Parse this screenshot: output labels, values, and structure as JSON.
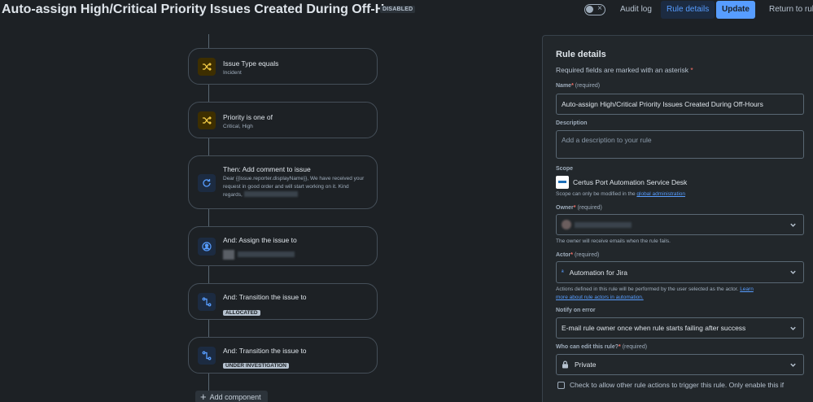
{
  "header": {
    "title": "Auto-assign High/Critical Priority Issues Created During Off-Hours",
    "status_badge": "DISABLED",
    "audit_log_label": "Audit log",
    "rule_details_label": "Rule details",
    "update_label": "Update",
    "return_label": "Return to rule"
  },
  "flow": {
    "cards": [
      {
        "title": "Issue Type equals",
        "subtitle": "Incident",
        "icon": "shuffle-icon"
      },
      {
        "title": "Priority is one of",
        "subtitle": "Critical, High",
        "icon": "shuffle-icon"
      },
      {
        "title": "Then: Add comment to issue",
        "subtitle": "Dear {{issue.reporter.displayName}}, We have received your request in good order and will start working on it. Kind regards,",
        "icon": "refresh-icon"
      },
      {
        "title": "And: Assign the issue to",
        "icon": "user-icon"
      },
      {
        "title": "And: Transition the issue to",
        "lozenge": "ALLOCATED",
        "icon": "transition-icon"
      },
      {
        "title": "And: Transition the issue to",
        "lozenge": "UNDER INVESTIGATION",
        "icon": "transition-icon"
      }
    ],
    "add_component_label": "Add component"
  },
  "panel": {
    "title": "Rule details",
    "required_note": "Required fields are marked with an asterisk",
    "name_label": "Name",
    "required_text": "(required)",
    "name_value": "Auto-assign High/Critical Priority Issues Created During Off-Hours",
    "description_label": "Description",
    "description_placeholder": "Add a description to your rule",
    "scope_label": "Scope",
    "scope_value": "Certus Port Automation Service Desk",
    "scope_help_prefix": "Scope can only be modified in the",
    "scope_help_link": "global administration",
    "owner_label": "Owner",
    "owner_help": "The owner will receive emails when the rule fails.",
    "actor_label": "Actor",
    "actor_value": "Automation for Jira",
    "actor_help_prefix": "Actions defined in this rule will be performed by the user selected as the actor.",
    "actor_help_link_1": "Learn",
    "actor_help_link_2": "more about rule actors in automation.",
    "notify_label": "Notify on error",
    "notify_value": "E-mail rule owner once when rule starts failing after success",
    "edit_label": "Who can edit this rule?",
    "edit_value": "Private",
    "checkbox_label": "Check to allow other rule actions to trigger this rule. Only enable this if"
  },
  "colors": {
    "background": "#1d2125",
    "panel": "#22272b",
    "accent": "#579dff",
    "condition_icon": "#f5cd47"
  }
}
